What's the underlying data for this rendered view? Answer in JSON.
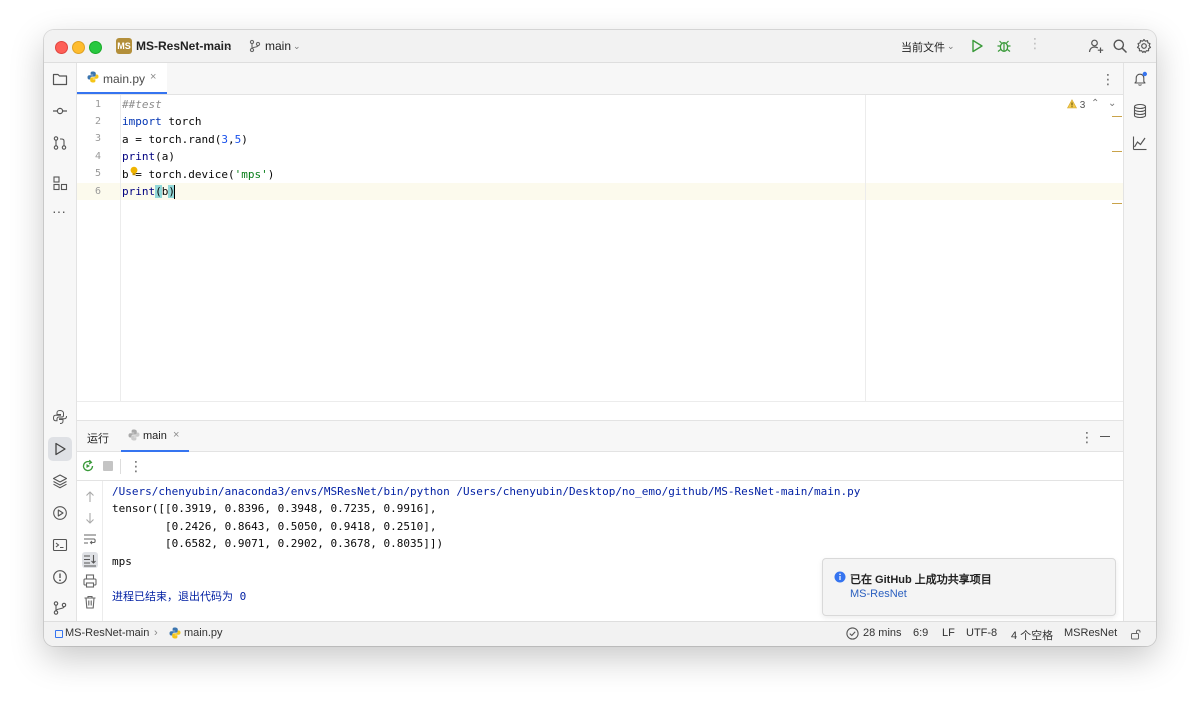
{
  "titlebar": {
    "project_badge": "MS",
    "project_name": "MS-ResNet-main",
    "branch": "main",
    "run_config": "当前文件"
  },
  "editor_tab": {
    "filename": "main.py",
    "close": "×"
  },
  "editor": {
    "lines": [
      {
        "n": "1"
      },
      {
        "n": "2"
      },
      {
        "n": "3"
      },
      {
        "n": "4"
      },
      {
        "n": "5"
      },
      {
        "n": "6"
      }
    ],
    "code": {
      "l1": "##test",
      "l2_kw": "import",
      "l2_rest": " torch",
      "l3_a": "a = torch.rand(",
      "l3_n1": "3",
      "l3_c": ",",
      "l3_n2": "5",
      "l3_e": ")",
      "l4_fn": "print",
      "l4_rest": "(a)",
      "l5_a": "b = torch.device(",
      "l5_str": "'mps'",
      "l5_e": ")",
      "l6_fn": "print",
      "l6_o": "(",
      "l6_b": "b",
      "l6_c": ")"
    },
    "warning_count": "3"
  },
  "run_panel": {
    "title": "运行",
    "tab_label": "main",
    "tab_close": "×",
    "console": [
      "/Users/chenyubin/anaconda3/envs/MSResNet/bin/python /Users/chenyubin/Desktop/no_emo/github/MS-ResNet-main/main.py",
      "tensor([[0.3919, 0.8396, 0.3948, 0.7235, 0.9916],",
      "        [0.2426, 0.8643, 0.5050, 0.9418, 0.2510],",
      "        [0.6582, 0.9071, 0.2902, 0.3678, 0.8035]])",
      "mps",
      "",
      "进程已结束，退出代码为 0"
    ]
  },
  "notification": {
    "title": "已在 GitHub 上成功共享项目",
    "link": "MS-ResNet"
  },
  "statusbar": {
    "project": "MS-ResNet-main",
    "file": "main.py",
    "time": "28 mins",
    "position": "6:9",
    "line_sep": "LF",
    "encoding": "UTF-8",
    "indent": "4 个空格",
    "interpreter": "MSResNet"
  },
  "colors": {
    "accent": "#3574f0",
    "project_badge": "#b38f3a",
    "run_green": "#3a9a3a",
    "current_line": "#fcfaed"
  }
}
